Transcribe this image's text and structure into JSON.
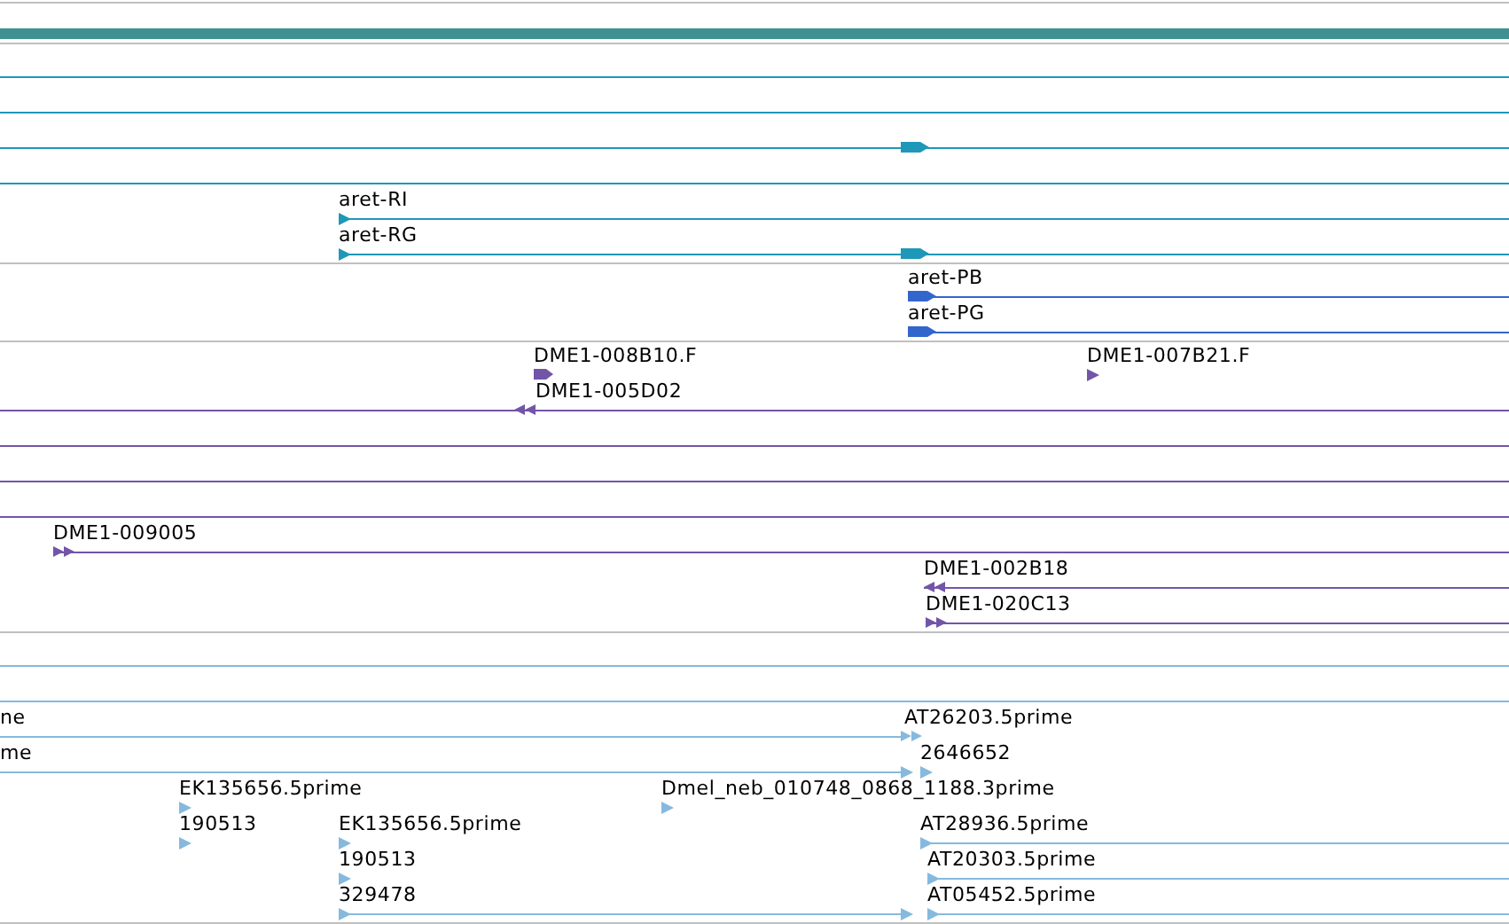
{
  "tracks": [
    {
      "color": "#1f97b8",
      "features": [
        {
          "reverse": false
        },
        {
          "label": "aret-RI",
          "reverse": false
        },
        {
          "label": "aret-RG",
          "reverse": false
        },
        {
          "reverse": false
        }
      ]
    },
    {
      "color": "#3366cc",
      "features": [
        {
          "label": "aret-PB",
          "reverse": false
        },
        {
          "label": "aret-PG",
          "reverse": false
        }
      ]
    },
    {
      "color": "#7355a8",
      "features": [
        {
          "label": "DME1-008B10.F",
          "reverse": false
        },
        {
          "label": "DME1-007B21.F",
          "reverse": false
        },
        {
          "label": "DME1-005D02",
          "reverse": true
        },
        {
          "label": "DME1-009005",
          "reverse": false
        },
        {
          "label": "DME1-002B18",
          "reverse": true
        },
        {
          "label": "DME1-020C13",
          "reverse": false
        }
      ]
    },
    {
      "color": "#86b9de",
      "features": [
        {
          "label": "ne",
          "reverse": false
        },
        {
          "label": "AT26203.5prime",
          "reverse": false
        },
        {
          "label": "me",
          "reverse": false
        },
        {
          "label": "2646652",
          "reverse": false
        },
        {
          "label": "EK135656.5prime",
          "reverse": false
        },
        {
          "label": "Dmel_neb_010748_0868_1188.3prime",
          "reverse": false
        },
        {
          "label": "190513",
          "reverse": false
        },
        {
          "label": "EK135656.5prime",
          "reverse": false
        },
        {
          "label": "AT28936.5prime",
          "reverse": false
        },
        {
          "label": "190513",
          "reverse": false
        },
        {
          "label": "AT20303.5prime",
          "reverse": false
        },
        {
          "label": "329478",
          "reverse": false
        },
        {
          "label": "AT05452.5prime",
          "reverse": false
        }
      ]
    }
  ]
}
